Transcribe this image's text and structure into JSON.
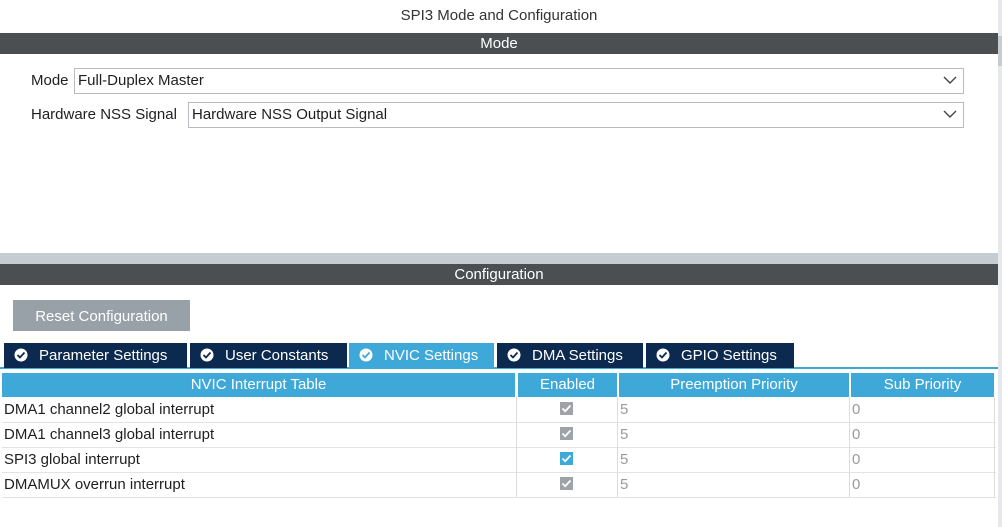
{
  "window_title": "SPI3 Mode and Configuration",
  "mode_section": {
    "title": "Mode",
    "fields": [
      {
        "label": "Mode",
        "value": "Full-Duplex Master"
      },
      {
        "label": "Hardware NSS Signal",
        "value": "Hardware NSS Output Signal"
      }
    ]
  },
  "config_section": {
    "title": "Configuration",
    "reset_button": "Reset Configuration",
    "tabs": [
      {
        "label": "Parameter Settings",
        "active": false
      },
      {
        "label": "User Constants",
        "active": false
      },
      {
        "label": "NVIC Settings",
        "active": true
      },
      {
        "label": "DMA Settings",
        "active": false
      },
      {
        "label": "GPIO Settings",
        "active": false
      }
    ],
    "table": {
      "headers": [
        "NVIC Interrupt Table",
        "Enabled",
        "Preemption Priority",
        "Sub Priority"
      ],
      "rows": [
        {
          "name": "DMA1 channel2 global interrupt",
          "enabled": true,
          "editable": false,
          "preemption": "5",
          "sub": "0"
        },
        {
          "name": "DMA1 channel3 global interrupt",
          "enabled": true,
          "editable": false,
          "preemption": "5",
          "sub": "0"
        },
        {
          "name": "SPI3 global interrupt",
          "enabled": true,
          "editable": true,
          "preemption": "5",
          "sub": "0"
        },
        {
          "name": "DMAMUX overrun interrupt",
          "enabled": true,
          "editable": false,
          "preemption": "5",
          "sub": "0"
        }
      ]
    }
  },
  "colors": {
    "section_bar": "#4b4f52",
    "accent": "#3ea8d8",
    "tab_inactive": "#0c2a4f",
    "button": "#99a1a8"
  }
}
